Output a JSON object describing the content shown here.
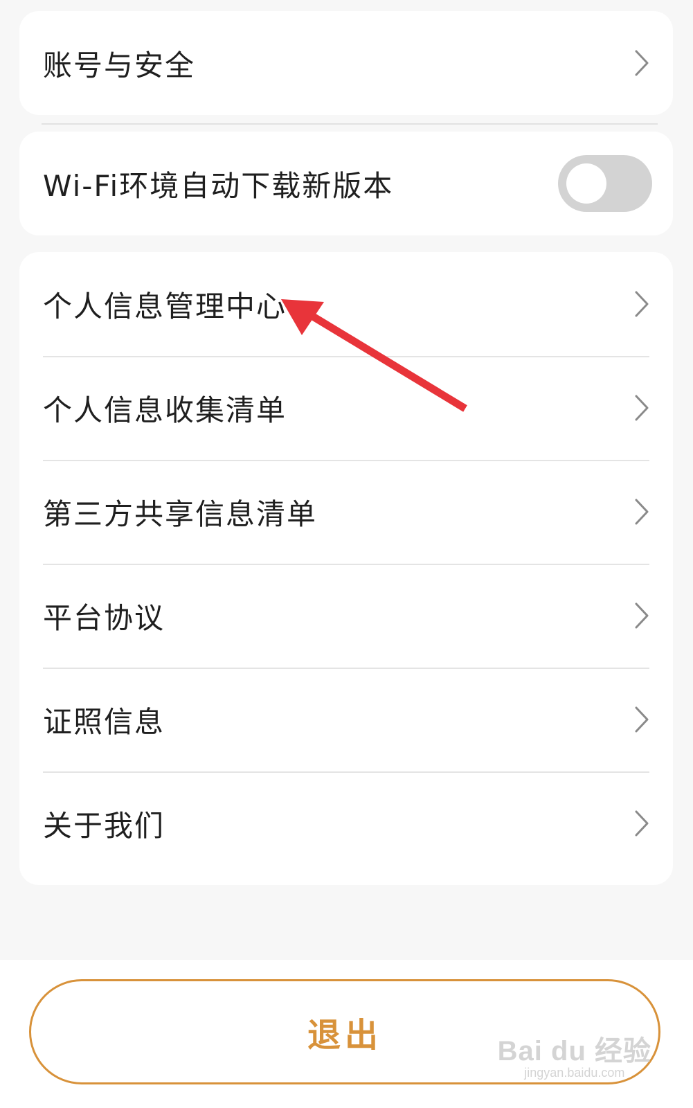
{
  "settings": {
    "account_security": "账号与安全",
    "wifi_auto_update": {
      "label": "Wi-Fi环境自动下载新版本",
      "enabled": false
    },
    "items": [
      {
        "label": "个人信息管理中心"
      },
      {
        "label": "个人信息收集清单"
      },
      {
        "label": "第三方共享信息清单"
      },
      {
        "label": "平台协议"
      },
      {
        "label": "证照信息"
      },
      {
        "label": "关于我们"
      }
    ]
  },
  "logout": {
    "label": "退出"
  },
  "annotation": {
    "arrow_color": "#e8343a"
  },
  "watermark": {
    "main": "Bai du 经验",
    "sub": "jingyan.baidu.com"
  },
  "colors": {
    "accent": "#d8923a",
    "toggle_off": "#d3d3d3",
    "background": "#f7f7f7"
  }
}
